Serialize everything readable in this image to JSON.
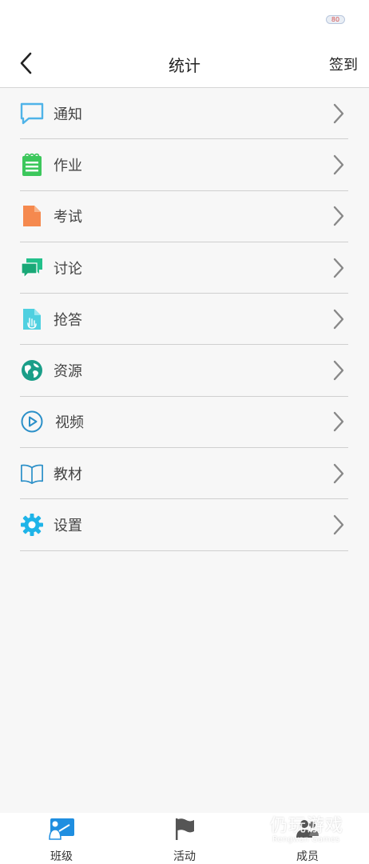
{
  "status_bar": {
    "battery": "80"
  },
  "header": {
    "title": "统计",
    "action_label": "签到"
  },
  "menu": {
    "items": [
      {
        "label": "通知",
        "icon": "chat-bubble-icon",
        "color": "#4fb3e8"
      },
      {
        "label": "作业",
        "icon": "notepad-icon",
        "color": "#3cc75c"
      },
      {
        "label": "考试",
        "icon": "document-icon",
        "color": "#f5894e"
      },
      {
        "label": "讨论",
        "icon": "discussion-icon",
        "color": "#22c08a"
      },
      {
        "label": "抢答",
        "icon": "file-hand-icon",
        "color": "#4fd0e0"
      },
      {
        "label": "资源",
        "icon": "globe-icon",
        "color": "#1a9e88"
      },
      {
        "label": "视频",
        "icon": "play-circle-icon",
        "color": "#2a8fc8"
      },
      {
        "label": "教材",
        "icon": "book-icon",
        "color": "#2a8fc8"
      },
      {
        "label": "设置",
        "icon": "gear-icon",
        "color": "#1fb4e8"
      }
    ]
  },
  "bottom_nav": {
    "tabs": [
      {
        "label": "班级",
        "icon": "class-icon",
        "active": true,
        "color": "#1f8ee0"
      },
      {
        "label": "活动",
        "icon": "flag-icon",
        "active": false,
        "color": "#555555"
      },
      {
        "label": "成员",
        "icon": "members-icon",
        "active": false,
        "color": "#555555"
      }
    ]
  },
  "watermark": {
    "title": "仍玩游戏",
    "subtitle": "Rengwan Games"
  }
}
